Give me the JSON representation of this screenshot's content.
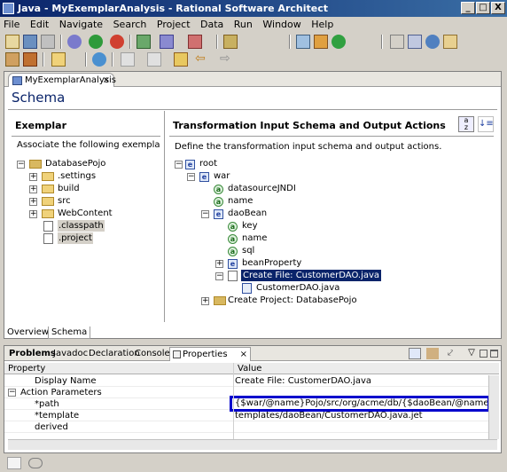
{
  "window": {
    "title": "Java - MyExemplarAnalysis - Rational Software Architect",
    "minimize": "_",
    "maximize": "□",
    "close": "X"
  },
  "menu": [
    "File",
    "Edit",
    "Navigate",
    "Search",
    "Project",
    "Data",
    "Run",
    "Window",
    "Help"
  ],
  "editor": {
    "tab_label": "MyExemplarAnalysis",
    "tab_close": "×",
    "heading": "Schema",
    "left_section_title": "Exemplar",
    "left_description": "Associate the following exemplar artifac",
    "left_tree": [
      {
        "label": "DatabasePojo"
      },
      {
        "label": ".settings"
      },
      {
        "label": "build"
      },
      {
        "label": "src"
      },
      {
        "label": "WebContent"
      },
      {
        "label": ".classpath"
      },
      {
        "label": ".project"
      }
    ],
    "right_section_title": "Transformation Input Schema and Output Actions",
    "right_description": "Define the transformation input schema and output actions.",
    "right_tree": [
      {
        "label": "root",
        "icon": "e"
      },
      {
        "label": "war",
        "icon": "e"
      },
      {
        "label": "datasourceJNDI",
        "icon": "a"
      },
      {
        "label": "name",
        "icon": "a"
      },
      {
        "label": "daoBean",
        "icon": "e"
      },
      {
        "label": "key",
        "icon": "a"
      },
      {
        "label": "name",
        "icon": "a"
      },
      {
        "label": "sql",
        "icon": "a"
      },
      {
        "label": "beanProperty",
        "icon": "e"
      },
      {
        "label": "Create File: CustomerDAO.java",
        "icon": "file"
      },
      {
        "label": "CustomerDAO.java",
        "icon": "java"
      },
      {
        "label": "Create Project: DatabasePojo",
        "icon": "project"
      }
    ],
    "bottom_tabs": [
      "Overview",
      "Schema"
    ]
  },
  "properties_view": {
    "tabs": [
      "Problems",
      "Javadoc",
      "Declaration",
      "Console",
      "Properties"
    ],
    "tab_close": "×",
    "col_property": "Property",
    "col_value": "Value",
    "rows": [
      {
        "key": "Display Name",
        "value": "Create File: CustomerDAO.java"
      },
      {
        "key": "Action Parameters",
        "value": ""
      },
      {
        "key": "*path",
        "value": "{$war/@name}Pojo/src/org/acme/db/{$daoBean/@name}DAO.java"
      },
      {
        "key": "*template",
        "value": "templates/daoBean/CustomerDAO.java.jet"
      },
      {
        "key": "derived",
        "value": ""
      }
    ],
    "group_toggle": "−",
    "highlight_color": "#0000cc"
  },
  "icons": {
    "title": "eclipse-icon",
    "sort": "sort-alpha-icon",
    "collapse": "collapse-all-icon"
  }
}
